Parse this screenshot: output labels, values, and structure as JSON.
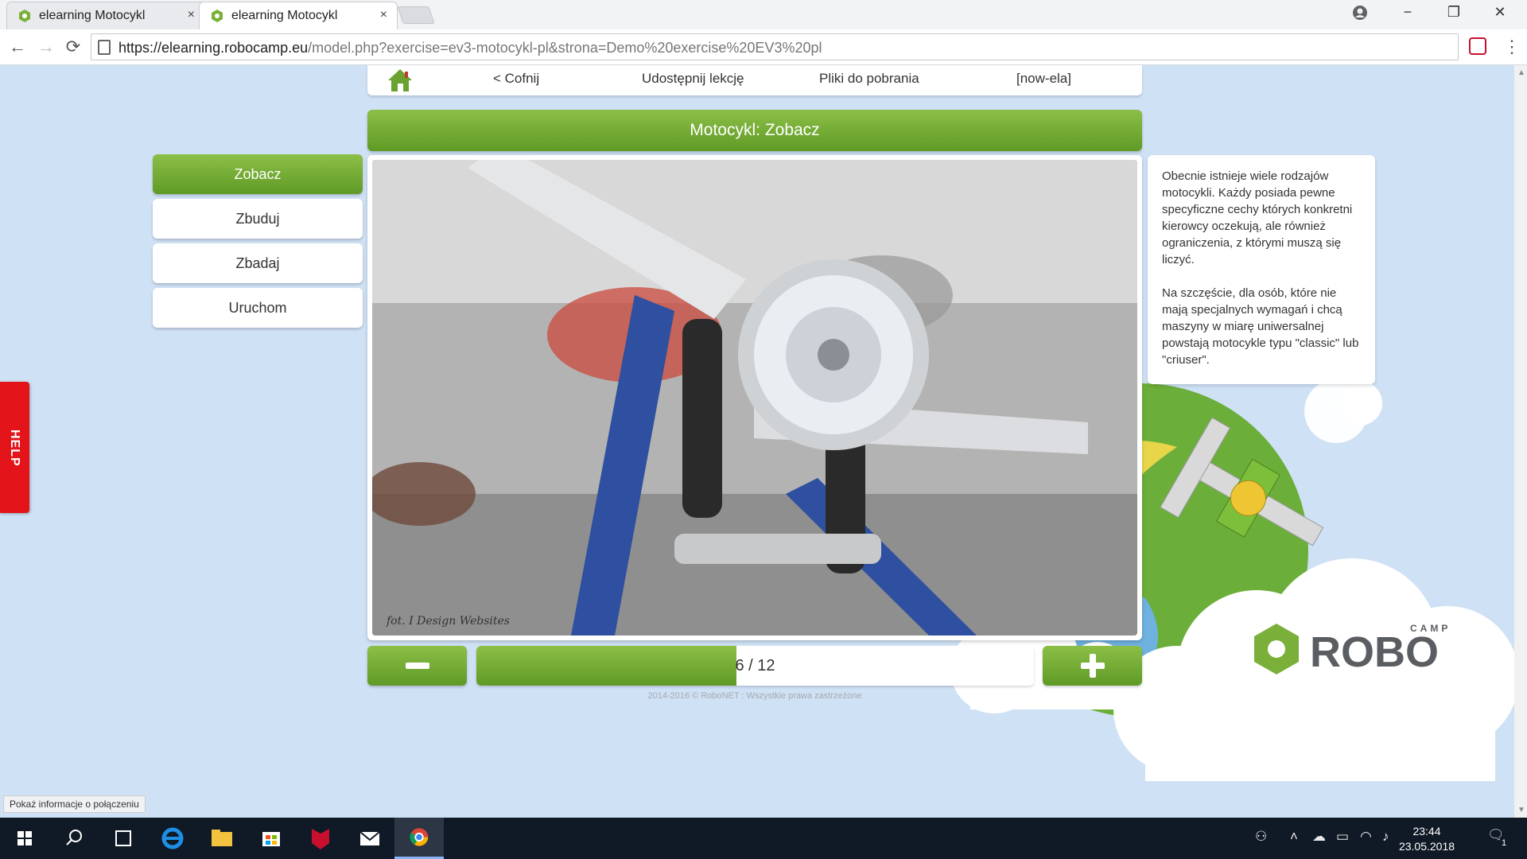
{
  "browser": {
    "tabs": [
      {
        "title": "elearning Motocykl",
        "close": "×"
      },
      {
        "title": "elearning Motocykl",
        "close": "×"
      }
    ],
    "controls": {
      "minimize": "−",
      "restore": "❐",
      "close": "✕"
    },
    "nav": {
      "back": "←",
      "forward": "→",
      "reload": "⟳"
    },
    "url_scheme_host": "https://elearning.robocamp.eu",
    "url_path": "/model.php?exercise=ev3-motocykl-pl&strona=Demo%20exercise%20EV3%20pl",
    "menu": "⋮"
  },
  "topnav": {
    "back": "< Cofnij",
    "share": "Udostępnij lekcję",
    "downloads": "Pliki do pobrania",
    "user": "[now-ela]"
  },
  "title": "Motocykl: Zobacz",
  "sidemenu": {
    "items": [
      {
        "label": "Zobacz",
        "active": true
      },
      {
        "label": "Zbuduj",
        "active": false
      },
      {
        "label": "Zbadaj",
        "active": false
      },
      {
        "label": "Uruchom",
        "active": false
      }
    ]
  },
  "photo": {
    "credit": "fot. I Design Websites"
  },
  "description": {
    "p1": "Obecnie istnieje wiele rodzajów motocykli. Każdy posiada pewne specyficzne cechy których konkretni kierowcy oczekują, ale również ograniczenia, z którymi muszą się liczyć.",
    "p2": "Na szczęście, dla osób, które nie mają specjalnych wymagań i chcą maszyny w miarę uniwersalnej powstają motocykle typu \"classic\" lub \"criuser\"."
  },
  "progress": {
    "counter": "6 / 12",
    "current": 6,
    "total": 12
  },
  "footer": {
    "copyright": "2014-2016 © RoboNET : Wszystkie prawa zastrzeżone"
  },
  "brand": {
    "camp": "CAMP",
    "robo": "ROBO"
  },
  "help": "HELP",
  "statusbar": {
    "text": "Pokaż informacje o połączeniu"
  },
  "taskbar": {
    "time": "23:44",
    "date": "23.05.2018",
    "notification_count": "1"
  },
  "colors": {
    "accent_green": "#7ab03a",
    "page_bg": "#cfe1f5",
    "help_red": "#e3151b"
  }
}
